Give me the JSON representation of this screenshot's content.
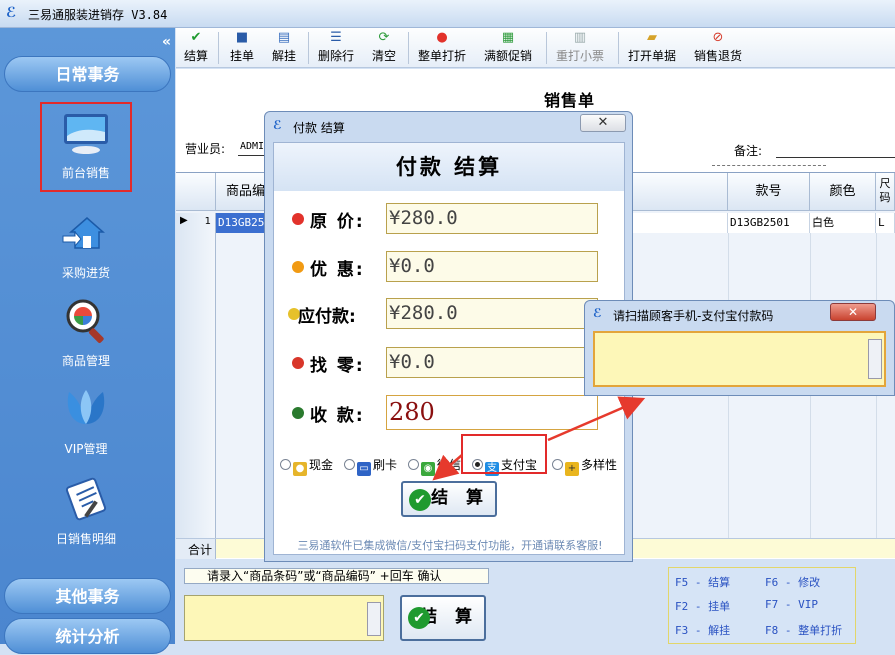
{
  "app": {
    "title": "三易通服装进销存 V3.84"
  },
  "sidebar": {
    "collapse": "«",
    "groups": [
      "日常事务",
      "其他事务",
      "统计分析"
    ],
    "items": [
      {
        "label": "前台销售",
        "icon": "monitor-icon"
      },
      {
        "label": "采购进货",
        "icon": "house-arrow-icon"
      },
      {
        "label": "商品管理",
        "icon": "magnifier-icon"
      },
      {
        "label": "VIP管理",
        "icon": "butterfly-icon"
      },
      {
        "label": "日销售明细",
        "icon": "clipboard-icon"
      }
    ]
  },
  "toolbar": {
    "buttons": [
      {
        "label": "结算",
        "icon": "✔"
      },
      {
        "label": "挂单",
        "icon": "💾"
      },
      {
        "label": "解挂",
        "icon": "📘"
      },
      {
        "label": "删除行",
        "icon": "✂"
      },
      {
        "label": "清空",
        "icon": "⟳"
      },
      {
        "label": "整单打折",
        "icon": "●"
      },
      {
        "label": "满额促销",
        "icon": "▦"
      },
      {
        "label": "重打小票",
        "icon": "🖨"
      },
      {
        "label": "打开单据",
        "icon": "📂"
      },
      {
        "label": "销售退货",
        "icon": "⊘"
      }
    ]
  },
  "form": {
    "title": "销售单",
    "salesman_label": "营业员:",
    "salesman_value": "ADMI",
    "remark_label": "备注:"
  },
  "grid": {
    "columns": [
      "商品编",
      "款号",
      "颜色",
      "尺码"
    ],
    "rows": [
      {
        "index": "1",
        "code": "D13GB250",
        "style": "D13GB2501",
        "color": "白色",
        "size": "L"
      }
    ],
    "total_label": "合计"
  },
  "bottom": {
    "hint": "请录入“商品条码”或“商品编码” +回车 确认",
    "settle_label": "结 算",
    "shortcuts": [
      "F5 - 结算",
      "F6 - 修改",
      "F2 - 挂单",
      "F7 - VIP",
      "F3 - 解挂",
      "F8 - 整单打折"
    ]
  },
  "pay_dialog": {
    "window_title": "付款 结算",
    "close": "✕",
    "heading": "付款 结算",
    "rows": [
      {
        "label": "原 价:",
        "value": "¥280.0"
      },
      {
        "label": "优 惠:",
        "value": "¥0.0"
      },
      {
        "label": "应付款:",
        "value": "¥280.0"
      },
      {
        "label": "找 零:",
        "value": "¥0.0"
      },
      {
        "label": "收 款:",
        "value": "280"
      }
    ],
    "methods": [
      "现金",
      "刷卡",
      "微信",
      "支付宝",
      "多样性"
    ],
    "selected_method": "支付宝",
    "settle_label": "结 算",
    "footer": "三易通软件已集成微信/支付宝扫码支付功能，开通请联系客服!"
  },
  "alipay_popup": {
    "title": "请扫描顾客手机-支付宝付款码",
    "close": "✕"
  }
}
